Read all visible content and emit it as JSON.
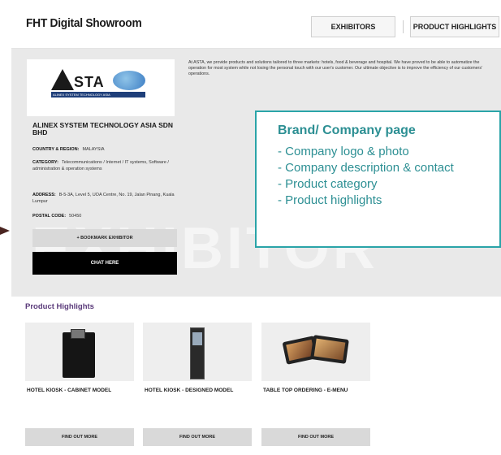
{
  "header": {
    "title": "FHT Digital Showroom",
    "nav": [
      "EXHIBITORS",
      "PRODUCT HIGHLIGHTS"
    ]
  },
  "company": {
    "logo_text": "STA",
    "logo_subtitle": "ALINEX SYSTEM TECHNOLOGY ASIA",
    "description": "At ASTA, we provide products and solutions tailored to three markets: hotels, food & beverage and hospital. We have proved to be able to automatize the operation for most system while not losing the personal touch with our user's customer. Our ultimate objective is to improve the efficiency of our customers' operations.",
    "name": "ALINEX SYSTEM TECHNOLOGY ASIA SDN BHD",
    "fields": [
      {
        "label": "COUNTRY & REGION:",
        "value": "MALAYSIA"
      },
      {
        "label": "CATEGORY:",
        "value": "Telecommunications / Internet / IT systems, Software / administration & operation systems"
      },
      {
        "label": "ADDRESS:",
        "value": "B-5-3A, Level 5, UOA Centre, No. 19, Jalan Pinang, Kuala Lumpur"
      },
      {
        "label": "POSTAL CODE:",
        "value": "50450"
      }
    ],
    "bookmark_label": "+ BOOKMARK EXHIBITOR",
    "chat_label": "CHAT HERE"
  },
  "watermark": "EXHIBITOR",
  "annotation": {
    "title": "Brand/ Company page",
    "items": [
      "- Company logo & photo",
      "- Company description & contact",
      "- Product category",
      "- Product highlights"
    ],
    "color": "#2aa4a8"
  },
  "highlights": {
    "title": "Product Highlights",
    "products": [
      {
        "name": "HOTEL KIOSK - CABINET MODEL",
        "button": "FIND OUT MORE",
        "icon": "cabinet-kiosk-image"
      },
      {
        "name": "HOTEL KIOSK - DESIGNED MODEL",
        "button": "FIND OUT MORE",
        "icon": "tower-kiosk-image"
      },
      {
        "name": "TABLE TOP ORDERING - E-MENU",
        "button": "FIND OUT MORE",
        "icon": "tablet-menu-image"
      }
    ]
  }
}
